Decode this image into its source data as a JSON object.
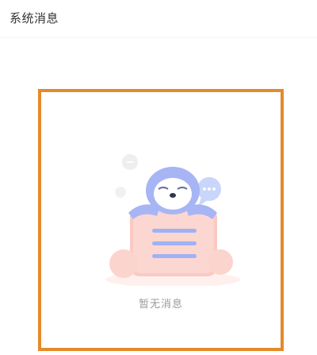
{
  "header": {
    "title": "系统消息"
  },
  "empty_state": {
    "message": "暂无消息",
    "illustration": "sloth-on-message-card-icon",
    "highlight_color": "#e58a2a"
  }
}
